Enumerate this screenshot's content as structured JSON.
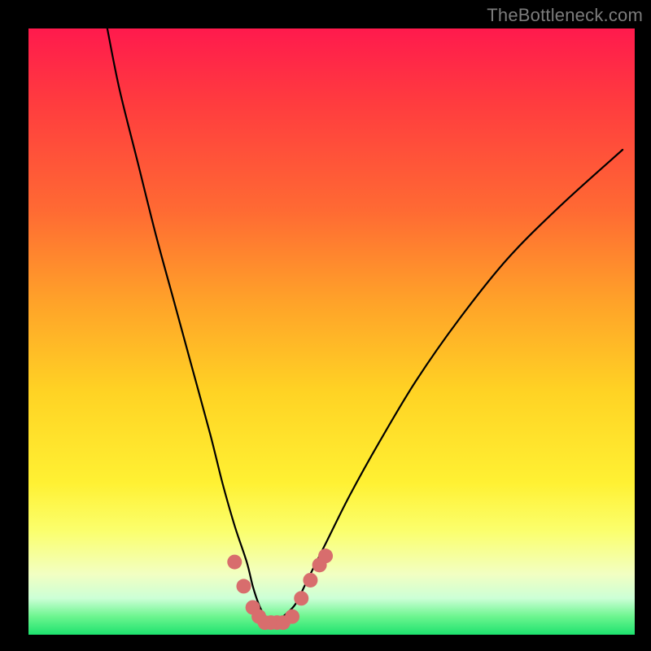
{
  "watermark": "TheBottleneck.com",
  "colors": {
    "frame": "#000000",
    "curve": "#000000",
    "marker": "#d86d6d",
    "gradient_stops": [
      "#ff1a4d",
      "#ff3b3f",
      "#ff6a33",
      "#ffa229",
      "#ffd324",
      "#fff133",
      "#fbff6e",
      "#f2ffc2",
      "#ccffd6",
      "#6cf58f",
      "#1de26e"
    ]
  },
  "chart_data": {
    "type": "line",
    "title": "",
    "xlabel": "",
    "ylabel": "",
    "xlim": [
      0,
      100
    ],
    "ylim": [
      0,
      100
    ],
    "series": [
      {
        "name": "bottleneck-curve",
        "x": [
          13,
          15,
          18,
          21,
          24,
          27,
          30,
          32,
          34,
          36,
          37,
          38,
          39,
          40,
          41,
          42,
          44,
          46,
          49,
          53,
          58,
          64,
          71,
          79,
          88,
          98
        ],
        "y": [
          100,
          90,
          78,
          66,
          55,
          44,
          33,
          25,
          18,
          12,
          8,
          5,
          3,
          2,
          2,
          3,
          5,
          9,
          15,
          23,
          32,
          42,
          52,
          62,
          71,
          80
        ]
      }
    ],
    "markers": {
      "name": "highlight-dots",
      "x": [
        34.0,
        35.5,
        37.0,
        38.0,
        39.0,
        40.0,
        41.0,
        42.0,
        43.5,
        45.0,
        46.5,
        48.0,
        49.0
      ],
      "y": [
        12.0,
        8.0,
        4.5,
        3.0,
        2.0,
        2.0,
        2.0,
        2.0,
        3.0,
        6.0,
        9.0,
        11.5,
        13.0
      ],
      "radius": 9
    }
  }
}
